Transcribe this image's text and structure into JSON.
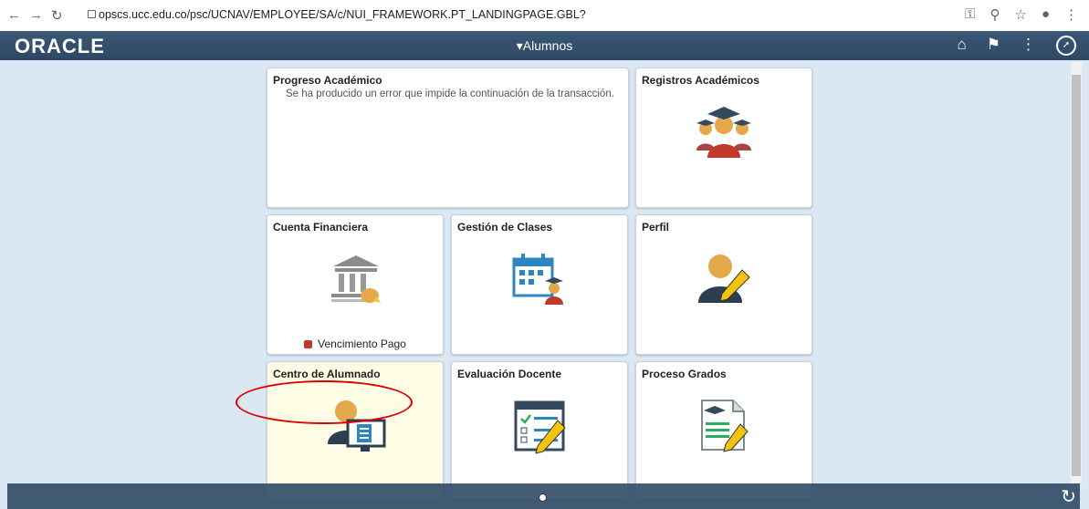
{
  "browser": {
    "url": "opscs.ucc.edu.co/psc/UCNAV/EMPLOYEE/SA/c/NUI_FRAMEWORK.PT_LANDINGPAGE.GBL?"
  },
  "header": {
    "logo": "ORACLE",
    "page_title": "▾Alumnos"
  },
  "tiles": [
    {
      "title": "Progreso Académico",
      "message": "Se ha producido un error que impide la continuación de la transacción."
    },
    {
      "title": "Registros Académicos"
    },
    {
      "title": "Cuenta Financiera",
      "badge": "Vencimiento Pago"
    },
    {
      "title": "Gestión de Clases"
    },
    {
      "title": "Perfil"
    },
    {
      "title": "Centro de Alumnado"
    },
    {
      "title": "Evaluación Docente"
    },
    {
      "title": "Proceso Grados"
    }
  ]
}
